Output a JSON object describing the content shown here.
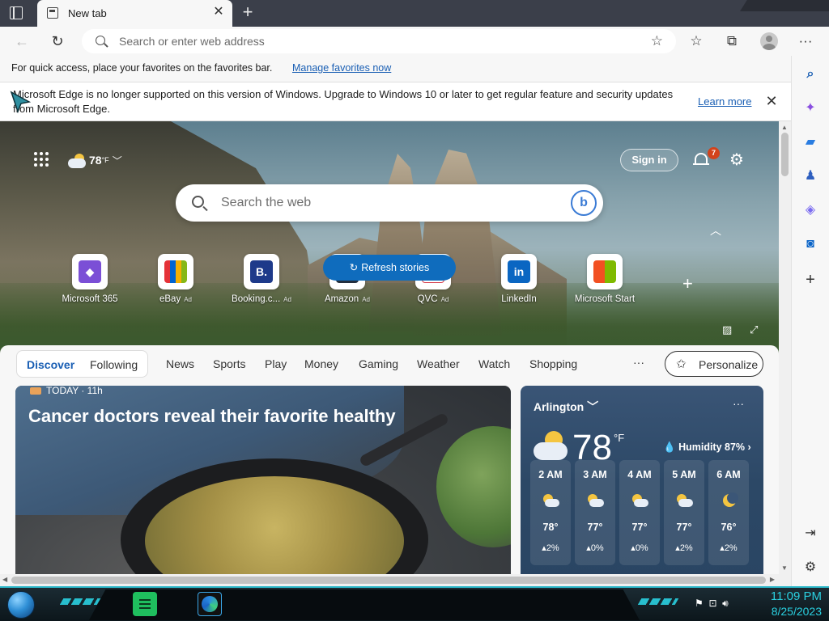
{
  "browser": {
    "tab": {
      "title": "New tab"
    },
    "address": {
      "placeholder": "Search or enter web address"
    }
  },
  "favorites_bar": {
    "message": "For quick access, place your favorites on the favorites bar.",
    "link": "Manage favorites now"
  },
  "infobar": {
    "message": "Microsoft Edge is no longer supported on this version of Windows. Upgrade to Windows 10 or later to get regular feature and security updates from Microsoft Edge.",
    "link": "Learn more"
  },
  "newtab": {
    "weather": {
      "temp": "78",
      "unit": "°F"
    },
    "sign_in": "Sign in",
    "notifications": "7",
    "search": {
      "placeholder": "Search the web"
    },
    "quick_links": [
      {
        "label": "Microsoft 365",
        "ad": "",
        "glyph": "◆",
        "color": "#7b4fd6"
      },
      {
        "label": "eBay",
        "ad": "Ad",
        "glyph": "▆",
        "color": "#e53238"
      },
      {
        "label": "Booking.c...",
        "ad": "Ad",
        "glyph": "B.",
        "color": "#1e3a8a"
      },
      {
        "label": "Amazon",
        "ad": "Ad",
        "glyph": "a",
        "color": "#232f3e"
      },
      {
        "label": "QVC",
        "ad": "Ad",
        "glyph": "Q",
        "color": "#d23b4b"
      },
      {
        "label": "LinkedIn",
        "ad": "",
        "glyph": "in",
        "color": "#0a66c2"
      },
      {
        "label": "Microsoft Start",
        "ad": "",
        "glyph": "▦",
        "color": "#f25022"
      }
    ]
  },
  "feed": {
    "segments": [
      "Discover",
      "Following"
    ],
    "nav": [
      "News",
      "Sports",
      "Play",
      "Money",
      "Gaming",
      "Weather",
      "Watch",
      "Shopping"
    ],
    "more": "···",
    "personalize": "Personalize",
    "refresh": "Refresh stories",
    "hero": {
      "source": "TODAY · 11h",
      "title": "Cancer doctors reveal their favorite healthy"
    }
  },
  "weather_card": {
    "city": "Arlington",
    "temp": "78",
    "unit": "°F",
    "humidity": "Humidity 87%",
    "hourly": [
      {
        "time": "2 AM",
        "temp": "78°",
        "precip": "2%",
        "icon": "cloud"
      },
      {
        "time": "3 AM",
        "temp": "77°",
        "precip": "0%",
        "icon": "cloud"
      },
      {
        "time": "4 AM",
        "temp": "77°",
        "precip": "0%",
        "icon": "cloud"
      },
      {
        "time": "5 AM",
        "temp": "77°",
        "precip": "2%",
        "icon": "cloud"
      },
      {
        "time": "6 AM",
        "temp": "76°",
        "precip": "2%",
        "icon": "moon"
      }
    ]
  },
  "taskbar": {
    "time": "11:09 PM",
    "date": "8/25/2023"
  }
}
